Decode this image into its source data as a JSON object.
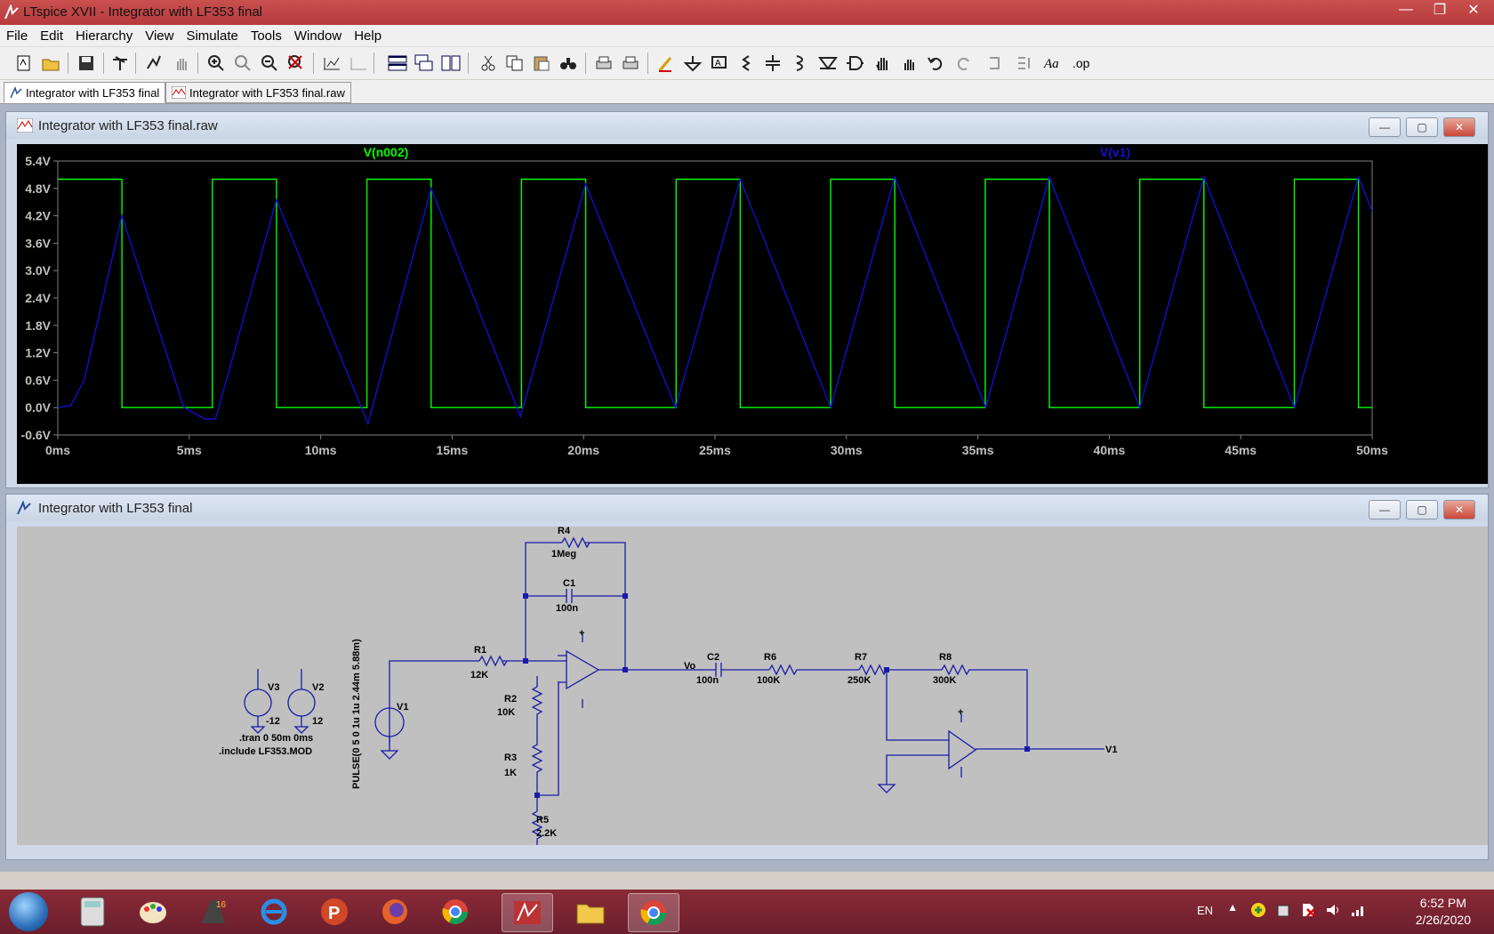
{
  "window": {
    "title": "LTspice XVII - Integrator with LF353 final"
  },
  "menu": [
    "File",
    "Edit",
    "Hierarchy",
    "View",
    "Simulate",
    "Tools",
    "Window",
    "Help"
  ],
  "tabs": [
    {
      "label": "Integrator with LF353 final",
      "active": true
    },
    {
      "label": "Integrator with LF353 final.raw",
      "active": false
    }
  ],
  "waveform_window": {
    "title": "Integrator with LF353 final.raw"
  },
  "schematic_window": {
    "title": "Integrator with LF353 final"
  },
  "chart_data": {
    "type": "line",
    "x_unit": "ms",
    "xlim": [
      0,
      50
    ],
    "ylim": [
      -0.6,
      5.4
    ],
    "x_ticks": [
      "0ms",
      "5ms",
      "10ms",
      "15ms",
      "20ms",
      "25ms",
      "30ms",
      "35ms",
      "40ms",
      "45ms",
      "50ms"
    ],
    "y_ticks": [
      "5.4V",
      "4.8V",
      "4.2V",
      "3.6V",
      "3.0V",
      "2.4V",
      "1.8V",
      "1.2V",
      "0.6V",
      "0.0V",
      "-0.6V"
    ],
    "series": [
      {
        "name": "V(n002)",
        "color": "#00ff00",
        "x": [
          0,
          2.44,
          2.44,
          5.88,
          5.88,
          8.32,
          8.32,
          11.76,
          11.76,
          14.2,
          14.2,
          17.64,
          17.64,
          20.08,
          20.08,
          23.52,
          23.52,
          25.96,
          25.96,
          29.4,
          29.4,
          31.84,
          31.84,
          35.28,
          35.28,
          37.72,
          37.72,
          41.16,
          41.16,
          43.6,
          43.6,
          47.04,
          47.04,
          49.48,
          49.48,
          50
        ],
        "y": [
          5,
          5,
          0,
          0,
          5,
          5,
          0,
          0,
          5,
          5,
          0,
          0,
          5,
          5,
          0,
          0,
          5,
          5,
          0,
          0,
          5,
          5,
          0,
          0,
          5,
          5,
          0,
          0,
          5,
          5,
          0,
          0,
          5,
          5,
          0,
          0
        ]
      },
      {
        "name": "V(v1)",
        "color": "#1010d0",
        "x": [
          0,
          0.5,
          1.0,
          2.44,
          4.8,
          5.6,
          6.0,
          8.32,
          11.8,
          14.2,
          17.6,
          20.08,
          23.5,
          25.96,
          29.4,
          31.84,
          35.3,
          37.72,
          41.16,
          43.6,
          47.04,
          49.48,
          50
        ],
        "y": [
          0,
          0.05,
          0.6,
          4.2,
          0,
          -0.25,
          -0.25,
          4.55,
          -0.35,
          4.8,
          -0.2,
          4.9,
          0,
          5.0,
          0,
          5.05,
          0,
          5.05,
          0,
          5.05,
          0,
          5.05,
          4.3
        ]
      }
    ]
  },
  "schematic": {
    "labels": {
      "R4": "R4",
      "R4v": "1Meg",
      "C1": "C1",
      "C1v": "100n",
      "R1": "R1",
      "R1v": "12K",
      "R2": "R2",
      "R2v": "10K",
      "R3": "R3",
      "R3v": "1K",
      "R5": "R5",
      "R5v": "2.2K",
      "C2": "C2",
      "C2v": "100n",
      "R6": "R6",
      "R6v": "100K",
      "R7": "R7",
      "R7v": "250K",
      "R8": "R8",
      "R8v": "300K",
      "Vo": "Vo",
      "V1net": "V1",
      "V1": "V1",
      "V2": "V2",
      "V2v": "12",
      "V3": "V3",
      "V3v": "-12",
      "plus": "+",
      "tran": ".tran 0 50m 0ms",
      "include": ".include LF353.MOD",
      "pulse": "PULSE(0 5 0 1u 1u 2.44m 5.88m)"
    }
  },
  "tray": {
    "lang": "EN",
    "time": "6:52 PM",
    "date": "2/26/2020"
  }
}
